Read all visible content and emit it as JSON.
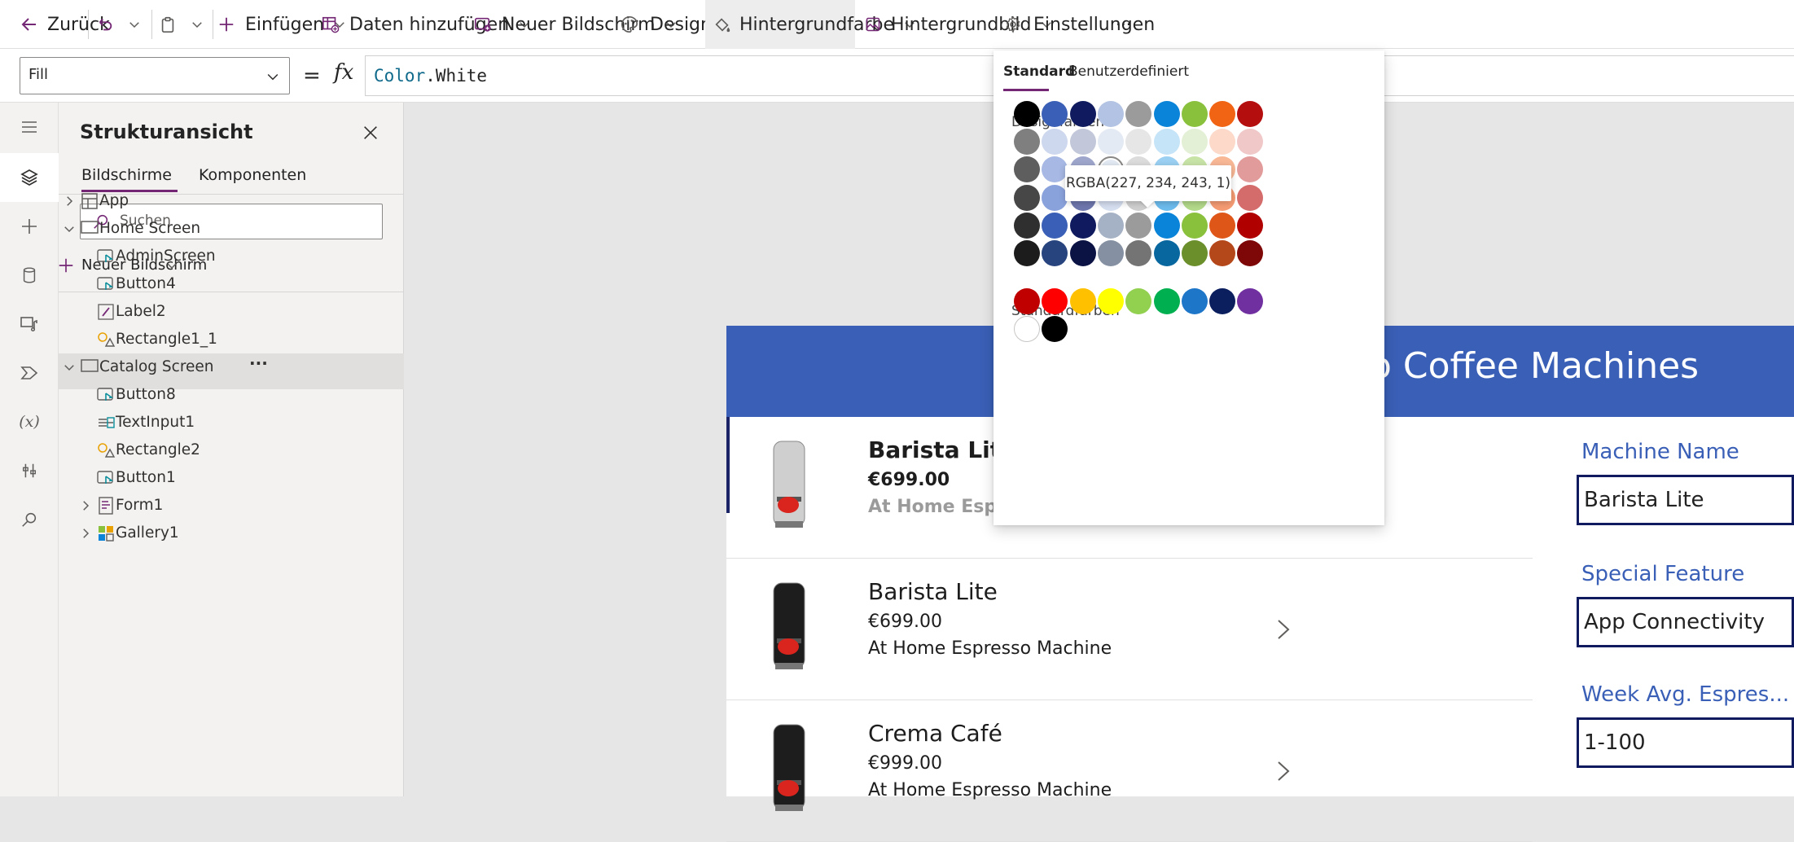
{
  "commandbar": {
    "back": "Zurück",
    "insert": "Einfügen",
    "add_data": "Daten hinzufügen",
    "new_screen": "Neuer Bildschirm",
    "design": "Design",
    "background_color": "Hintergrundfarbe",
    "background_image": "Hintergrundbild",
    "settings": "Einstellungen",
    "more": "···"
  },
  "formula_bar": {
    "property": "Fill",
    "equals": "=",
    "fx": "fx",
    "formula_object": "Color",
    "formula_member": ".White"
  },
  "tree": {
    "title": "Strukturansicht",
    "tabs": [
      "Bildschirme",
      "Komponenten"
    ],
    "search_placeholder": "Suchen",
    "new_screen": "Neuer Bildschirm",
    "items": [
      {
        "label": "App",
        "type": "app"
      },
      {
        "label": "Home Screen",
        "type": "screen"
      },
      {
        "label": "AdminScreen",
        "type": "button"
      },
      {
        "label": "Button4",
        "type": "button"
      },
      {
        "label": "Label2",
        "type": "label"
      },
      {
        "label": "Rectangle1_1",
        "type": "shape"
      },
      {
        "label": "Catalog Screen",
        "type": "screen",
        "more": "···"
      },
      {
        "label": "Button8",
        "type": "button"
      },
      {
        "label": "TextInput1",
        "type": "textinput"
      },
      {
        "label": "Rectangle2",
        "type": "shape"
      },
      {
        "label": "Button1",
        "type": "button"
      },
      {
        "label": "Form1",
        "type": "form"
      },
      {
        "label": "Gallery1",
        "type": "gallery"
      }
    ]
  },
  "app": {
    "header_title": "o Coffee Machines",
    "gallery": [
      {
        "name": "Barista Lite",
        "price": "€699.00",
        "description": "At Home Espr"
      },
      {
        "name": "Barista Lite",
        "price": "€699.00",
        "description": "At Home Espresso Machine"
      },
      {
        "name": "Crema Café",
        "price": "€999.00",
        "description": "At Home Espresso Machine"
      }
    ],
    "form": [
      {
        "label": "Machine Name",
        "value": "Barista Lite"
      },
      {
        "label": "Special Feature",
        "value": "App Connectivity"
      },
      {
        "label": "Week Avg. Espres...",
        "value": "1-100"
      }
    ]
  },
  "color_picker": {
    "tabs": [
      "Standard",
      "Benutzerdefiniert"
    ],
    "design_colors_label": "Designfarben",
    "standard_colors_label": "Standardfarben",
    "tooltip": "RGBA(227, 234, 243, 1)",
    "design_colors": [
      [
        "#000000",
        "#3a5fb6",
        "#0f1b5e",
        "#b3c3e3",
        "#9b9b9b",
        "#0a84d8",
        "#8ac13c",
        "#f06414",
        "#b50e0e"
      ],
      [
        "#7f7f7f",
        "#cdd7ee",
        "#c2c8d9",
        "#e3eaf3",
        "#e6e6e6",
        "#c6e4f8",
        "#e3f0d5",
        "#fcd9c9",
        "#f0c8c8"
      ],
      [
        "#5e5e5e",
        "#a6b8e3",
        "#9ea6cc",
        "#e3eaf3",
        "#dcdcdc",
        "#9bd0f2",
        "#c8e3a6",
        "#f8b896",
        "#e29b9b"
      ],
      [
        "#474747",
        "#8aa2dc",
        "#6e77ad",
        "#d6dff0",
        "#cfcfcf",
        "#6dbcee",
        "#b3d98a",
        "#f69c74",
        "#d56c6c"
      ],
      [
        "#2f2f2f",
        "#3a5fb6",
        "#0f1b5e",
        "#a5b1c4",
        "#9b9b9b",
        "#0a84d8",
        "#8ac13c",
        "#df5619",
        "#b00000"
      ],
      [
        "#1c1c1c",
        "#27447f",
        "#0b1244",
        "#8591a3",
        "#747474",
        "#09679f",
        "#6b8f2b",
        "#b5481a",
        "#7e0707"
      ]
    ],
    "standard_colors": [
      "#c00000",
      "#ff0000",
      "#ffc000",
      "#ffff00",
      "#92d050",
      "#00b050",
      "#1e76c9",
      "#0b1f5e",
      "#7030a0",
      "#ffffff",
      "#000000"
    ]
  }
}
